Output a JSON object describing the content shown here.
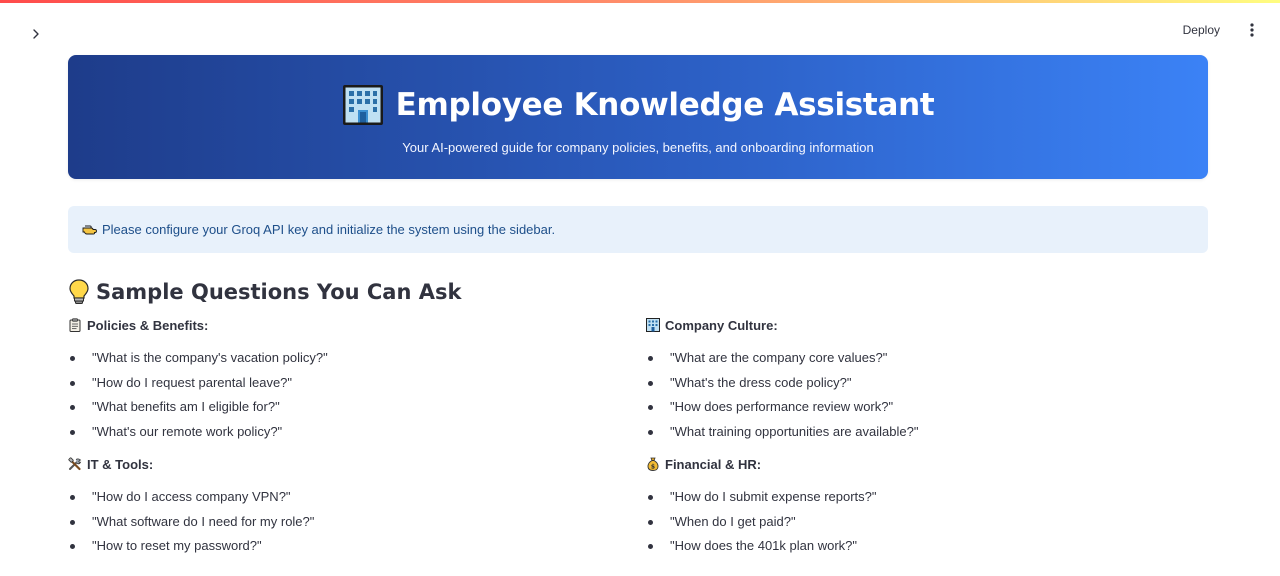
{
  "header": {
    "deploy_label": "Deploy",
    "icons": {
      "sidebar_toggle": "chevron-right-icon",
      "menu": "kebab-menu-icon"
    }
  },
  "hero": {
    "icon": "office-building-icon",
    "title": "Employee Knowledge Assistant",
    "subtitle": "Your AI-powered guide for company policies, benefits, and onboarding information",
    "gradient_start": "#1e3c8a",
    "gradient_end": "#3b82f6"
  },
  "info": {
    "icon": "pointing-hand-icon",
    "message": "Please configure your Groq API key and initialize the system using the sidebar.",
    "background": "#e8f1fb",
    "text_color": "#1e4f8a"
  },
  "samples": {
    "icon": "light-bulb-icon",
    "heading": "Sample Questions You Can Ask",
    "groups": [
      {
        "icon": "clipboard-icon",
        "title": "Policies & Benefits:",
        "questions": [
          "\"What is the company's vacation policy?\"",
          "\"How do I request parental leave?\"",
          "\"What benefits am I eligible for?\"",
          "\"What's our remote work policy?\""
        ]
      },
      {
        "icon": "tools-icon",
        "title": "IT & Tools:",
        "questions": [
          "\"How do I access company VPN?\"",
          "\"What software do I need for my role?\"",
          "\"How to reset my password?\""
        ]
      },
      {
        "icon": "office-building-icon",
        "title": "Company Culture:",
        "questions": [
          "\"What are the company core values?\"",
          "\"What's the dress code policy?\"",
          "\"How does performance review work?\"",
          "\"What training opportunities are available?\""
        ]
      },
      {
        "icon": "money-bag-icon",
        "title": "Financial & HR:",
        "questions": [
          "\"How do I submit expense reports?\"",
          "\"When do I get paid?\"",
          "\"How does the 401k plan work?\""
        ]
      }
    ]
  }
}
